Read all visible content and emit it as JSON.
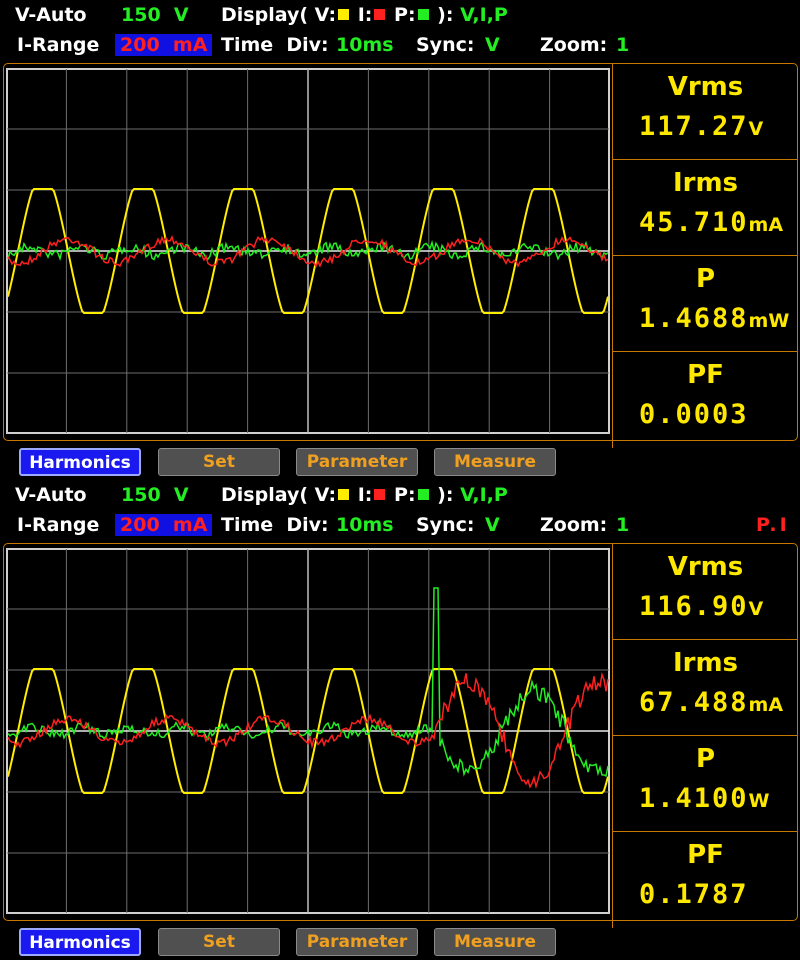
{
  "panels": [
    {
      "v_mode": "V-Auto",
      "v_range": "150  V",
      "display_label": "Display(",
      "disp_v": "V:",
      "disp_i": "I:",
      "disp_p": "P:",
      "disp_close": "):",
      "display_value": "V,I,P",
      "i_range_label": "I-Range",
      "i_range_value": "200  mA",
      "time_div_label": "Time  Div:",
      "time_div_value": "10ms",
      "sync_label": "Sync:",
      "sync_value": "V",
      "zoom_label": "Zoom:",
      "zoom_value": "1",
      "status": "",
      "measurements": [
        {
          "name": "Vrms",
          "value": "117.27",
          "unit": "V"
        },
        {
          "name": "Irms",
          "value": "45.710",
          "unit": "mA"
        },
        {
          "name": "P",
          "value": "1.4688",
          "unit": "mW"
        },
        {
          "name": "PF",
          "value": "0.0003",
          "unit": ""
        }
      ],
      "buttons": {
        "harmonics": "Harmonics",
        "set": "Set",
        "parameter": "Parameter",
        "measure": "Measure"
      }
    },
    {
      "v_mode": "V-Auto",
      "v_range": "150  V",
      "display_label": "Display(",
      "disp_v": "V:",
      "disp_i": "I:",
      "disp_p": "P:",
      "disp_close": "):",
      "display_value": "V,I,P",
      "i_range_label": "I-Range",
      "i_range_value": "200  mA",
      "time_div_label": "Time  Div:",
      "time_div_value": "10ms",
      "sync_label": "Sync:",
      "sync_value": "V",
      "zoom_label": "Zoom:",
      "zoom_value": "1",
      "status": "P.I",
      "measurements": [
        {
          "name": "Vrms",
          "value": "116.90",
          "unit": "V"
        },
        {
          "name": "Irms",
          "value": "67.488",
          "unit": "mA"
        },
        {
          "name": "P",
          "value": "1.4100",
          "unit": "W"
        },
        {
          "name": "PF",
          "value": "0.1787",
          "unit": ""
        }
      ],
      "buttons": {
        "harmonics": "Harmonics",
        "set": "Set",
        "parameter": "Parameter",
        "measure": "Measure"
      }
    }
  ],
  "colors": {
    "voltage": "#ffee00",
    "current": "#ff2020",
    "power": "#22ee22",
    "accent": "#c87800",
    "grid": "#7a7a7a"
  }
}
